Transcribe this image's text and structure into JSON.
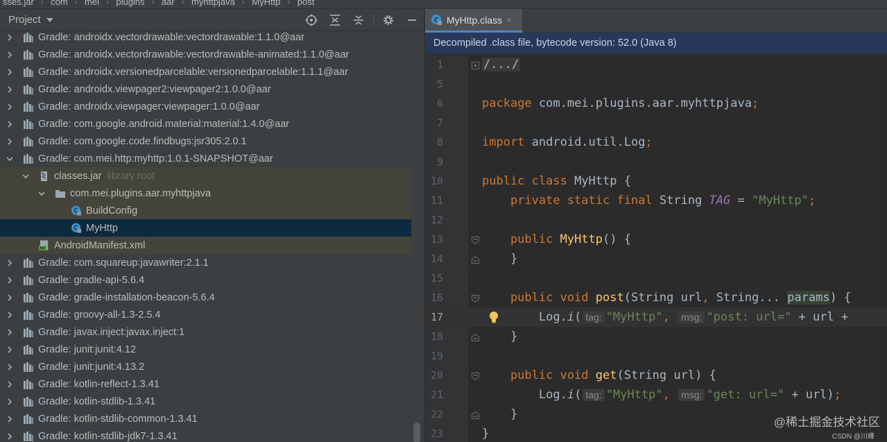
{
  "breadcrumb": {
    "items": [
      "sses.jar",
      "com",
      "mei",
      "plugins",
      "aar",
      "myhttpjava",
      "MyHttp",
      "post"
    ]
  },
  "project_panel": {
    "title": "Project",
    "tools": [
      "locate-icon",
      "expand-all-icon",
      "collapse-all-icon",
      "gear-icon",
      "hide-icon"
    ],
    "tree": [
      {
        "label": "Gradle: androidx.vectordrawable:vectordrawable:1.1.0@aar",
        "hint": "",
        "level": 0,
        "expanded": false,
        "icon": "library-icon",
        "state": ""
      },
      {
        "label": "Gradle: androidx.vectordrawable:vectordrawable-animated:1.1.0@aar",
        "hint": "",
        "level": 0,
        "expanded": false,
        "icon": "library-icon",
        "state": ""
      },
      {
        "label": "Gradle: androidx.versionedparcelable:versionedparcelable:1.1.1@aar",
        "hint": "",
        "level": 0,
        "expanded": false,
        "icon": "library-icon",
        "state": ""
      },
      {
        "label": "Gradle: androidx.viewpager2:viewpager2:1.0.0@aar",
        "hint": "",
        "level": 0,
        "expanded": false,
        "icon": "library-icon",
        "state": ""
      },
      {
        "label": "Gradle: androidx.viewpager:viewpager:1.0.0@aar",
        "hint": "",
        "level": 0,
        "expanded": false,
        "icon": "library-icon",
        "state": ""
      },
      {
        "label": "Gradle: com.google.android.material:material:1.4.0@aar",
        "hint": "",
        "level": 0,
        "expanded": false,
        "icon": "library-icon",
        "state": ""
      },
      {
        "label": "Gradle: com.google.code.findbugs:jsr305:2.0.1",
        "hint": "",
        "level": 0,
        "expanded": false,
        "icon": "library-icon",
        "state": ""
      },
      {
        "label": "Gradle: com.mei.http:myhttp:1.0.1-SNAPSHOT@aar",
        "hint": "",
        "level": 0,
        "expanded": true,
        "icon": "library-icon",
        "state": ""
      },
      {
        "label": "classes.jar",
        "hint": "library root",
        "level": 1,
        "expanded": true,
        "icon": "jar-icon",
        "state": "sel-parent"
      },
      {
        "label": "com.mei.plugins.aar.myhttpjava",
        "hint": "",
        "level": 2,
        "expanded": true,
        "icon": "package-icon",
        "state": "sel-parent"
      },
      {
        "label": "BuildConfig",
        "hint": "",
        "level": 3,
        "expanded": null,
        "icon": "class-icon",
        "state": "sel-parent"
      },
      {
        "label": "MyHttp",
        "hint": "",
        "level": 3,
        "expanded": null,
        "icon": "class-icon",
        "state": "selected"
      },
      {
        "label": "AndroidManifest.xml",
        "hint": "",
        "level": 1,
        "expanded": null,
        "icon": "manifest-icon",
        "state": "sel-parent"
      },
      {
        "label": "Gradle: com.squareup:javawriter:2.1.1",
        "hint": "",
        "level": 0,
        "expanded": false,
        "icon": "library-icon",
        "state": ""
      },
      {
        "label": "Gradle: gradle-api-5.6.4",
        "hint": "",
        "level": 0,
        "expanded": false,
        "icon": "library-icon",
        "state": ""
      },
      {
        "label": "Gradle: gradle-installation-beacon-5.6.4",
        "hint": "",
        "level": 0,
        "expanded": false,
        "icon": "library-icon",
        "state": ""
      },
      {
        "label": "Gradle: groovy-all-1.3-2.5.4",
        "hint": "",
        "level": 0,
        "expanded": false,
        "icon": "library-icon",
        "state": ""
      },
      {
        "label": "Gradle: javax.inject:javax.inject:1",
        "hint": "",
        "level": 0,
        "expanded": false,
        "icon": "library-icon",
        "state": ""
      },
      {
        "label": "Gradle: junit:junit:4.12",
        "hint": "",
        "level": 0,
        "expanded": false,
        "icon": "library-icon",
        "state": ""
      },
      {
        "label": "Gradle: junit:junit:4.13.2",
        "hint": "",
        "level": 0,
        "expanded": false,
        "icon": "library-icon",
        "state": ""
      },
      {
        "label": "Gradle: kotlin-reflect-1.3.41",
        "hint": "",
        "level": 0,
        "expanded": false,
        "icon": "library-icon",
        "state": ""
      },
      {
        "label": "Gradle: kotlin-stdlib-1.3.41",
        "hint": "",
        "level": 0,
        "expanded": false,
        "icon": "library-icon",
        "state": ""
      },
      {
        "label": "Gradle: kotlin-stdlib-common-1.3.41",
        "hint": "",
        "level": 0,
        "expanded": false,
        "icon": "library-icon",
        "state": ""
      },
      {
        "label": "Gradle: kotlin-stdlib-jdk7-1.3.41",
        "hint": "",
        "level": 0,
        "expanded": false,
        "icon": "library-icon",
        "state": ""
      }
    ]
  },
  "editor": {
    "tab": {
      "label": "MyHttp.class",
      "close": "×"
    },
    "banner": "Decompiled .class file, bytecode version: 52.0 (Java 8)",
    "current_line": "17",
    "lines": [
      {
        "n": "1",
        "fold": "plus",
        "tokens": [
          {
            "t": "/.../",
            "c": "folded"
          }
        ]
      },
      {
        "n": "5",
        "fold": "",
        "tokens": []
      },
      {
        "n": "6",
        "fold": "",
        "tokens": [
          {
            "t": "package ",
            "c": "kw"
          },
          {
            "t": "com.mei.plugins.aar.myhttpjava",
            "c": ""
          },
          {
            "t": ";",
            "c": "kw"
          }
        ]
      },
      {
        "n": "7",
        "fold": "",
        "tokens": []
      },
      {
        "n": "8",
        "fold": "",
        "tokens": [
          {
            "t": "import ",
            "c": "kw"
          },
          {
            "t": "android.util.Log",
            "c": ""
          },
          {
            "t": ";",
            "c": "kw"
          }
        ]
      },
      {
        "n": "9",
        "fold": "",
        "tokens": []
      },
      {
        "n": "10",
        "fold": "",
        "tokens": [
          {
            "t": "public class ",
            "c": "kw"
          },
          {
            "t": "MyHttp {",
            "c": ""
          }
        ]
      },
      {
        "n": "11",
        "fold": "",
        "tokens": [
          {
            "t": "    private static final ",
            "c": "kw"
          },
          {
            "t": "String ",
            "c": ""
          },
          {
            "t": "TAG",
            "c": "fld"
          },
          {
            "t": " = ",
            "c": ""
          },
          {
            "t": "\"MyHttp\"",
            "c": "str"
          },
          {
            "t": ";",
            "c": "kw"
          }
        ]
      },
      {
        "n": "12",
        "fold": "",
        "tokens": []
      },
      {
        "n": "13",
        "fold": "open",
        "tokens": [
          {
            "t": "    public ",
            "c": "kw"
          },
          {
            "t": "MyHttp",
            "c": "fn"
          },
          {
            "t": "() {",
            "c": ""
          }
        ]
      },
      {
        "n": "14",
        "fold": "close",
        "tokens": [
          {
            "t": "    }",
            "c": ""
          }
        ]
      },
      {
        "n": "15",
        "fold": "",
        "tokens": []
      },
      {
        "n": "16",
        "fold": "open",
        "tokens": [
          {
            "t": "    public void ",
            "c": "kw"
          },
          {
            "t": "post",
            "c": "fn"
          },
          {
            "t": "(String url",
            "c": ""
          },
          {
            "t": ", ",
            "c": "kw"
          },
          {
            "t": "String... ",
            "c": ""
          },
          {
            "t": "params",
            "c": "params-hl"
          },
          {
            "t": ") {",
            "c": ""
          }
        ]
      },
      {
        "n": "17",
        "fold": "",
        "tokens": [
          {
            "t": "        Log.",
            "c": ""
          },
          {
            "t": "i",
            "c": "mth"
          },
          {
            "t": "(",
            "c": ""
          },
          {
            "t": "tag:",
            "c": "hint"
          },
          {
            "t": "\"MyHttp\"",
            "c": "str"
          },
          {
            "t": ", ",
            "c": "kw"
          },
          {
            "t": "msg:",
            "c": "hint"
          },
          {
            "t": "\"post: url=\"",
            "c": "str"
          },
          {
            "t": " + url +",
            "c": ""
          }
        ]
      },
      {
        "n": "18",
        "fold": "close",
        "tokens": [
          {
            "t": "    }",
            "c": ""
          }
        ]
      },
      {
        "n": "19",
        "fold": "",
        "tokens": []
      },
      {
        "n": "20",
        "fold": "open",
        "tokens": [
          {
            "t": "    public void ",
            "c": "kw"
          },
          {
            "t": "get",
            "c": "fn"
          },
          {
            "t": "(String url) {",
            "c": ""
          }
        ]
      },
      {
        "n": "21",
        "fold": "",
        "tokens": [
          {
            "t": "        Log.",
            "c": ""
          },
          {
            "t": "i",
            "c": "mth"
          },
          {
            "t": "(",
            "c": ""
          },
          {
            "t": "tag:",
            "c": "hint"
          },
          {
            "t": "\"MyHttp\"",
            "c": "str"
          },
          {
            "t": ", ",
            "c": "kw"
          },
          {
            "t": "msg:",
            "c": "hint"
          },
          {
            "t": "\"get: url=\"",
            "c": "str"
          },
          {
            "t": " + url)",
            "c": ""
          },
          {
            "t": ";",
            "c": "kw"
          }
        ]
      },
      {
        "n": "22",
        "fold": "close",
        "tokens": [
          {
            "t": "    }",
            "c": ""
          }
        ]
      },
      {
        "n": "23",
        "fold": "",
        "tokens": [
          {
            "t": "}",
            "c": ""
          }
        ]
      }
    ]
  },
  "watermark": {
    "main": "@稀土掘金技术社区",
    "sub": "CSDN @川峰"
  },
  "colors": {
    "accent": "#4a88c7",
    "selection": "#0d293e",
    "keyword": "#cc7832",
    "string": "#6a8759",
    "method": "#ffc66d"
  }
}
